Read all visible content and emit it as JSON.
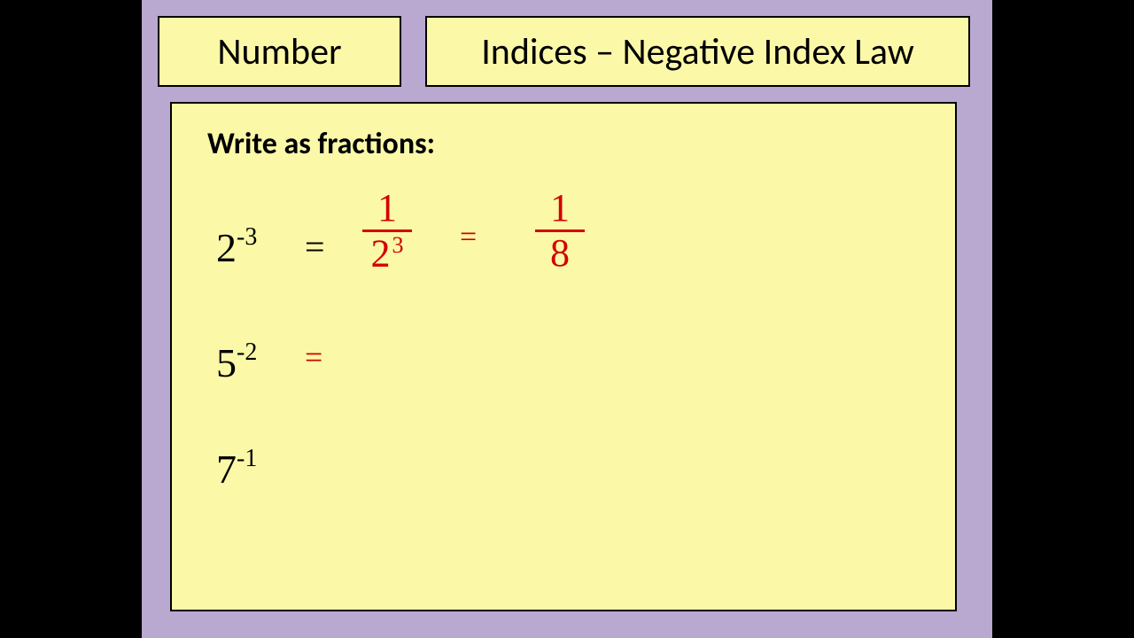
{
  "header": {
    "left": "Number",
    "right": "Indices – Negative Index Law"
  },
  "content": {
    "prompt": "Write as fractions:",
    "problems": [
      {
        "base": "2",
        "exp": "-3"
      },
      {
        "base": "5",
        "exp": "-2"
      },
      {
        "base": "7",
        "exp": "-1"
      }
    ],
    "work": {
      "eq1": "=",
      "frac1_num": "1",
      "frac1_den_base": "2",
      "frac1_den_exp": "3",
      "eq2": "=",
      "frac2_num": "1",
      "frac2_den": "8",
      "eq3": "="
    }
  }
}
